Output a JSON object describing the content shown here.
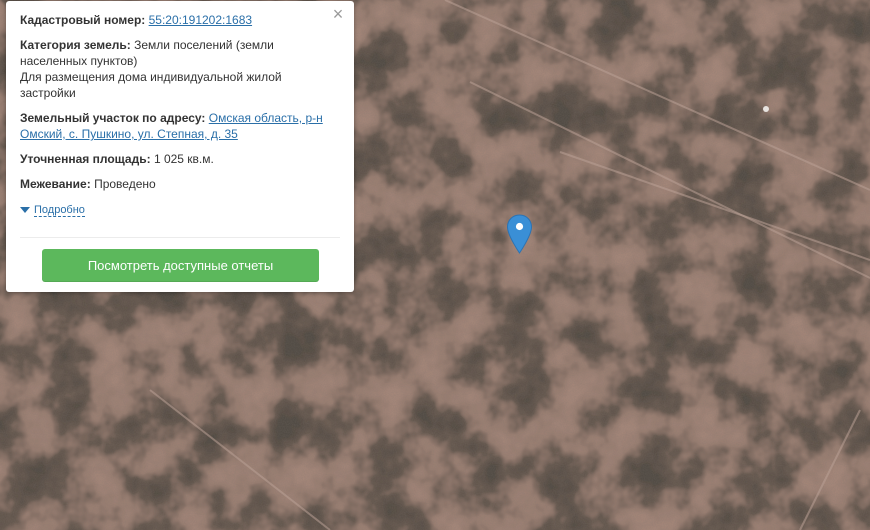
{
  "popup": {
    "close_icon": "×",
    "cadastral": {
      "label": "Кадастровый номер:",
      "value": "55:20:191202:1683"
    },
    "category": {
      "label": "Категория земель:",
      "value": "Земли поселений (земли населенных пунктов)",
      "purpose": "Для размещения дома индивидуальной жилой застройки"
    },
    "address": {
      "label": "Земельный участок по адресу:",
      "value": "Омская область, р-н Омский, с. Пушкино, ул. Степная, д. 35"
    },
    "area": {
      "label": "Уточненная площадь:",
      "value": "1 025 кв.м."
    },
    "survey": {
      "label": "Межевание:",
      "value": "Проведено"
    },
    "details_label": "Подробно",
    "report_button_label": "Посмотреть доступные отчеты"
  },
  "colors": {
    "button_green": "#5cb85c",
    "link_blue": "#2a6fa8",
    "marker_blue": "#3a8fd6",
    "terrain_light": "#a8887a",
    "terrain_dark": "#4e473f"
  },
  "icons": {
    "close": "close-icon",
    "details": "triangle-down-icon",
    "marker": "map-pin-icon"
  }
}
